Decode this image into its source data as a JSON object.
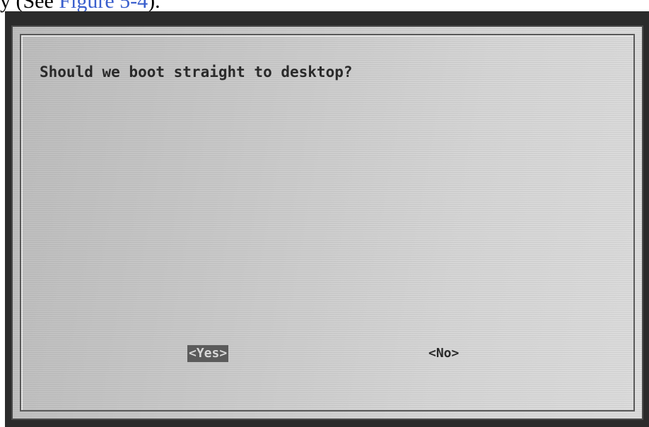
{
  "caption": {
    "prefix": "y (See ",
    "link_text": "Figure 5-4",
    "suffix": ")."
  },
  "dialog": {
    "question": "Should we boot straight to desktop?",
    "buttons": {
      "yes": "<Yes>",
      "no": "<No>"
    }
  },
  "colors": {
    "selected_button_bg": "#5b5b5b",
    "dialog_bg": "#c9c9c9",
    "screen_frame": "#2b2b2b"
  }
}
